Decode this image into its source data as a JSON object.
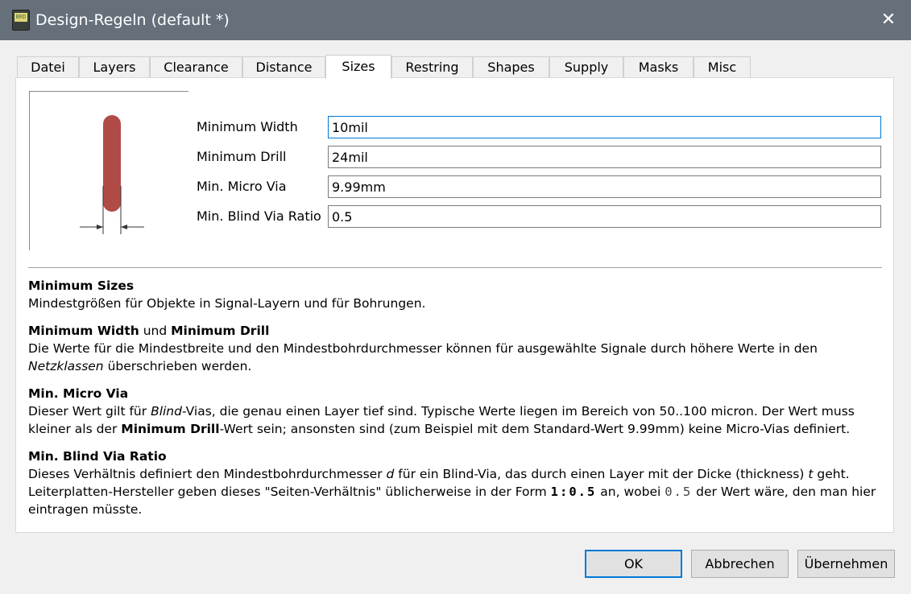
{
  "window": {
    "title": "Design-Regeln (default *)",
    "app_icon_text": "BRD",
    "close_glyph": "✕"
  },
  "tabs": [
    {
      "label": "Datei"
    },
    {
      "label": "Layers"
    },
    {
      "label": "Clearance"
    },
    {
      "label": "Distance"
    },
    {
      "label": "Sizes",
      "active": true
    },
    {
      "label": "Restring"
    },
    {
      "label": "Shapes"
    },
    {
      "label": "Supply"
    },
    {
      "label": "Masks"
    },
    {
      "label": "Misc"
    }
  ],
  "fields": [
    {
      "label": "Minimum Width",
      "value": "10mil"
    },
    {
      "label": "Minimum Drill",
      "value": "24mil"
    },
    {
      "label": "Min. Micro Via",
      "value": "9.99mm"
    },
    {
      "label": "Min. Blind Via Ratio",
      "value": "0.5"
    }
  ],
  "help": {
    "s1_title": "Minimum Sizes",
    "s1_body": "Mindestgrößen für Objekte in Signal-Layern und für Bohrungen.",
    "s2_title_a": "Minimum Width",
    "s2_title_mid": " und ",
    "s2_title_b": "Minimum Drill",
    "s2_body_a": "Die Werte für die Mindestbreite und den Mindestbohrdurchmesser können für ausgewählte Signale durch höhere Werte in den ",
    "s2_body_em": "Netzklassen",
    "s2_body_b": " überschrieben werden.",
    "s3_title": "Min. Micro Via",
    "s3_body_a": "Dieser Wert gilt für ",
    "s3_body_em": "Blind",
    "s3_body_b": "-Vias, die genau einen Layer tief sind. Typische Werte liegen im Bereich von 50..100 micron. Der Wert muss kleiner als der ",
    "s3_body_strong": "Minimum Drill",
    "s3_body_c": "-Wert sein; ansonsten sind (zum Beispiel mit dem Standard-Wert 9.99mm) keine Micro-Vias definiert.",
    "s4_title": "Min. Blind Via Ratio",
    "s4_body_a": "Dieses Verhältnis definiert den Mindestbohrdurchmesser ",
    "s4_body_d": "d",
    "s4_body_b": " für ein Blind-Via, das durch einen Layer mit der Dicke (thickness) ",
    "s4_body_t": "t",
    "s4_body_c": " geht. Leiterplatten-Hersteller geben dieses \"Seiten-Verhältnis\" üblicherweise in der Form ",
    "s4_code1": "1:0.5",
    "s4_body_d2": " an, wobei ",
    "s4_code2": "0.5",
    "s4_body_e": " der Wert wäre, den man hier eintragen müsste."
  },
  "buttons": {
    "ok": "OK",
    "cancel": "Abbrechen",
    "apply": "Übernehmen"
  },
  "colors": {
    "titlebar": "#65707b",
    "trace": "#b14b47",
    "focus_border": "#0078d7"
  }
}
